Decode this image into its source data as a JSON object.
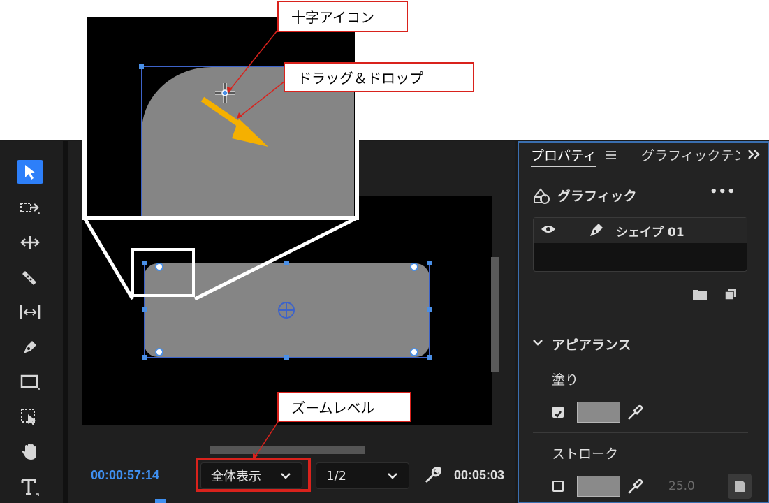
{
  "annotations": {
    "crosshair_label": "十字アイコン",
    "drag_label": "ドラッグ＆ドロップ",
    "zoom_label": "ズームレベル"
  },
  "monitor": {
    "current_timecode": "00:00:57:14",
    "zoom_level": "全体表示",
    "resolution": "1/2",
    "duration_timecode": "00:05:03"
  },
  "panel": {
    "tab_properties": "プロパティ",
    "tab_graphics": "グラフィックテン",
    "section_title": "グラフィック",
    "more_label": "•••",
    "layer_name": "シェイプ 01",
    "appearance_label": "アピアランス",
    "fill_label": "塗り",
    "stroke_label": "ストローク",
    "stroke_width": "25.0"
  },
  "colors": {
    "accent": "#2d7ff9",
    "timecode": "#3f8ff0",
    "selection": "#4a8fe6",
    "callout_border": "#d9221c",
    "arrow": "#f5b000",
    "shape_fill": "#858585"
  },
  "icons": [
    "selection-arrow-icon",
    "track-select-icon",
    "ripple-edit-icon",
    "razor-icon",
    "slip-icon",
    "pen-icon",
    "rectangle-icon",
    "shape-select-icon",
    "hand-icon",
    "type-icon",
    "eye-icon",
    "pen-layer-icon",
    "folder-icon",
    "new-layer-icon",
    "eyedropper-icon",
    "wrench-icon",
    "chevron-down-icon",
    "crosshair-icon",
    "anchor-point-icon"
  ]
}
